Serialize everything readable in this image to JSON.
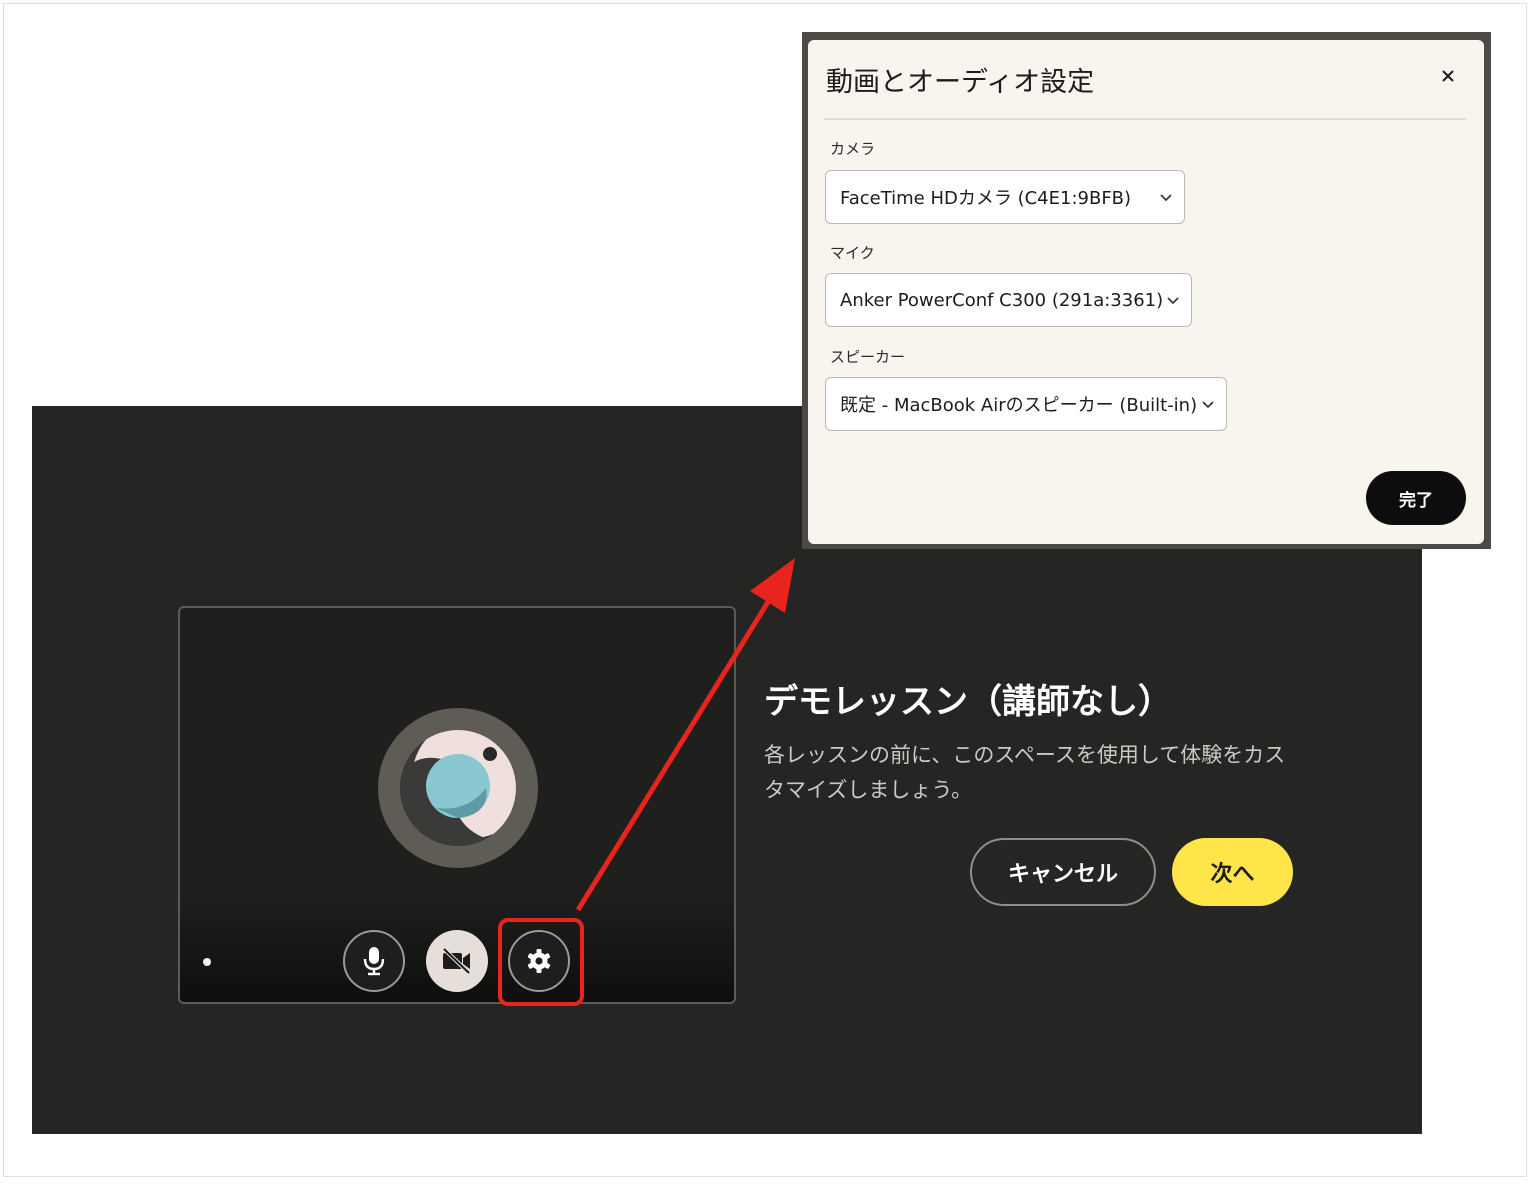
{
  "colors": {
    "page_background": "#ffffff",
    "lobby_background": "#252524",
    "modal_background": "#f8f4ee",
    "next_button": "#fde54a",
    "done_button": "#0d0d0d",
    "annotation_red": "#e8241c"
  },
  "lobby": {
    "title": "デモレッスン（講師なし）",
    "description": "各レッスンの前に、このスペースを使用して体験をカスタマイズしましょう。",
    "cancel_label": "キャンセル",
    "next_label": "次へ",
    "video_controls": [
      {
        "icon": "microphone-icon"
      },
      {
        "icon": "camera-off-icon"
      },
      {
        "icon": "gear-icon"
      }
    ]
  },
  "settings_modal": {
    "title": "動画とオーディオ設定",
    "close_icon": "×",
    "camera_label": "カメラ",
    "camera_value": "FaceTime HDカメラ (C4E1:9BFB)",
    "mic_label": "マイク",
    "mic_value": "Anker PowerConf C300 (291a:3361)",
    "speaker_label": "スピーカー",
    "speaker_value": "既定 - MacBook Airのスピーカー (Built-in)",
    "done_label": "完了"
  }
}
